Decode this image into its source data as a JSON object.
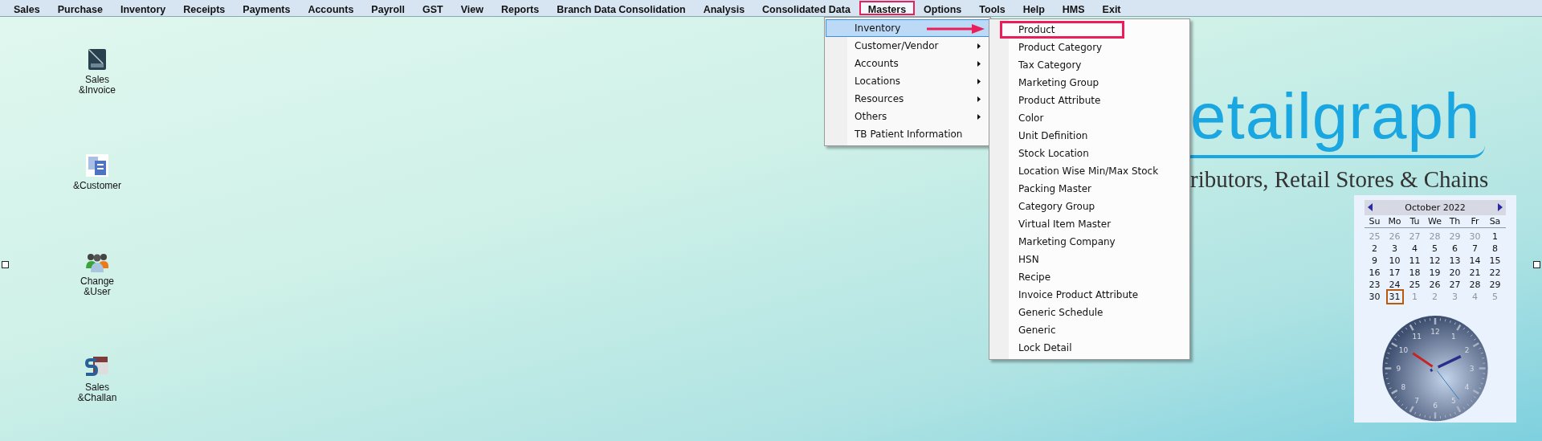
{
  "menu_bar": [
    {
      "label": "Sales",
      "selected": false
    },
    {
      "label": "Purchase",
      "selected": false
    },
    {
      "label": "Inventory",
      "selected": false
    },
    {
      "label": "Receipts",
      "selected": false
    },
    {
      "label": "Payments",
      "selected": false
    },
    {
      "label": "Accounts",
      "selected": false
    },
    {
      "label": "Payroll",
      "selected": false
    },
    {
      "label": "GST",
      "selected": false
    },
    {
      "label": "View",
      "selected": false
    },
    {
      "label": "Reports",
      "selected": false
    },
    {
      "label": "Branch Data Consolidation",
      "selected": false
    },
    {
      "label": "Analysis",
      "selected": false
    },
    {
      "label": "Consolidated Data",
      "selected": false
    },
    {
      "label": "Masters",
      "selected": true
    },
    {
      "label": "Options",
      "selected": false
    },
    {
      "label": "Tools",
      "selected": false
    },
    {
      "label": "Help",
      "selected": false
    },
    {
      "label": "HMS",
      "selected": false
    },
    {
      "label": "Exit",
      "selected": false
    }
  ],
  "desktop_icons": [
    {
      "label": "Sales &Invoice",
      "kind": "invoice"
    },
    {
      "label": "&Customer",
      "kind": "documents"
    },
    {
      "label": "Change &User",
      "kind": "users"
    },
    {
      "label": "Sales &Challan",
      "kind": "challan"
    }
  ],
  "masters_menu": [
    {
      "label": "Inventory",
      "has_submenu": false,
      "selected": true
    },
    {
      "label": "Customer/Vendor",
      "has_submenu": true,
      "selected": false
    },
    {
      "label": "Accounts",
      "has_submenu": true,
      "selected": false
    },
    {
      "label": "Locations",
      "has_submenu": true,
      "selected": false
    },
    {
      "label": "Resources",
      "has_submenu": true,
      "selected": false
    },
    {
      "label": "Others",
      "has_submenu": true,
      "selected": false
    },
    {
      "label": "TB Patient Information",
      "has_submenu": false,
      "selected": false
    }
  ],
  "inventory_submenu": [
    {
      "label": "Product",
      "selected": true
    },
    {
      "label": "Product Category",
      "selected": false
    },
    {
      "label": "Tax Category",
      "selected": false
    },
    {
      "label": "Marketing Group",
      "selected": false
    },
    {
      "label": "Product Attribute",
      "selected": false
    },
    {
      "label": "Color",
      "selected": false
    },
    {
      "label": "Unit Definition",
      "selected": false
    },
    {
      "label": "Stock Location",
      "selected": false
    },
    {
      "label": "Location Wise Min/Max Stock",
      "selected": false
    },
    {
      "label": "Packing Master",
      "selected": false
    },
    {
      "label": "Category Group",
      "selected": false
    },
    {
      "label": "Virtual Item Master",
      "selected": false
    },
    {
      "label": "Marketing Company",
      "selected": false
    },
    {
      "label": "HSN",
      "selected": false
    },
    {
      "label": "Recipe",
      "selected": false
    },
    {
      "label": "Invoice Product Attribute",
      "selected": false
    },
    {
      "label": "Generic Schedule",
      "selected": false
    },
    {
      "label": "Generic",
      "selected": false
    },
    {
      "label": "Lock Detail",
      "selected": false
    }
  ],
  "logo": {
    "wordmark": "etailgraph",
    "tagline": "ributors, Retail Stores & Chains"
  },
  "calendar": {
    "month": "October  2022",
    "weekdays": [
      "Su",
      "Mo",
      "Tu",
      "We",
      "Th",
      "Fr",
      "Sa"
    ],
    "days": [
      {
        "text": "25",
        "kind": "adjacent",
        "selected": false
      },
      {
        "text": "26",
        "kind": "adjacent",
        "selected": false
      },
      {
        "text": "27",
        "kind": "adjacent",
        "selected": false
      },
      {
        "text": "28",
        "kind": "adjacent",
        "selected": false
      },
      {
        "text": "29",
        "kind": "adjacent",
        "selected": false
      },
      {
        "text": "30",
        "kind": "adjacent",
        "selected": false
      },
      {
        "text": "1",
        "kind": "current",
        "selected": false
      },
      {
        "text": "2",
        "kind": "current",
        "selected": false
      },
      {
        "text": "3",
        "kind": "current",
        "selected": false
      },
      {
        "text": "4",
        "kind": "current",
        "selected": false
      },
      {
        "text": "5",
        "kind": "current",
        "selected": false
      },
      {
        "text": "6",
        "kind": "current",
        "selected": false
      },
      {
        "text": "7",
        "kind": "current",
        "selected": false
      },
      {
        "text": "8",
        "kind": "current",
        "selected": false
      },
      {
        "text": "9",
        "kind": "current",
        "selected": false
      },
      {
        "text": "10",
        "kind": "current",
        "selected": false
      },
      {
        "text": "11",
        "kind": "current",
        "selected": false
      },
      {
        "text": "12",
        "kind": "current",
        "selected": false
      },
      {
        "text": "13",
        "kind": "current",
        "selected": false
      },
      {
        "text": "14",
        "kind": "current",
        "selected": false
      },
      {
        "text": "15",
        "kind": "current",
        "selected": false
      },
      {
        "text": "16",
        "kind": "current",
        "selected": false
      },
      {
        "text": "17",
        "kind": "current",
        "selected": false
      },
      {
        "text": "18",
        "kind": "current",
        "selected": false
      },
      {
        "text": "19",
        "kind": "current",
        "selected": false
      },
      {
        "text": "20",
        "kind": "current",
        "selected": false
      },
      {
        "text": "21",
        "kind": "current",
        "selected": false
      },
      {
        "text": "22",
        "kind": "current",
        "selected": false
      },
      {
        "text": "23",
        "kind": "current",
        "selected": false
      },
      {
        "text": "24",
        "kind": "current",
        "selected": false
      },
      {
        "text": "25",
        "kind": "current",
        "selected": false
      },
      {
        "text": "26",
        "kind": "current",
        "selected": false
      },
      {
        "text": "27",
        "kind": "current",
        "selected": false
      },
      {
        "text": "28",
        "kind": "current",
        "selected": false
      },
      {
        "text": "29",
        "kind": "current",
        "selected": false
      },
      {
        "text": "30",
        "kind": "current",
        "selected": false
      },
      {
        "text": "31",
        "kind": "current",
        "selected": true
      },
      {
        "text": "1",
        "kind": "adjacent",
        "selected": false
      },
      {
        "text": "2",
        "kind": "adjacent",
        "selected": false
      },
      {
        "text": "3",
        "kind": "adjacent",
        "selected": false
      },
      {
        "text": "4",
        "kind": "adjacent",
        "selected": false
      },
      {
        "text": "5",
        "kind": "adjacent",
        "selected": false
      }
    ]
  },
  "clock": {
    "numbers": [
      "12",
      "1",
      "2",
      "3",
      "4",
      "5",
      "6",
      "7",
      "8",
      "9",
      "10",
      "11"
    ]
  }
}
